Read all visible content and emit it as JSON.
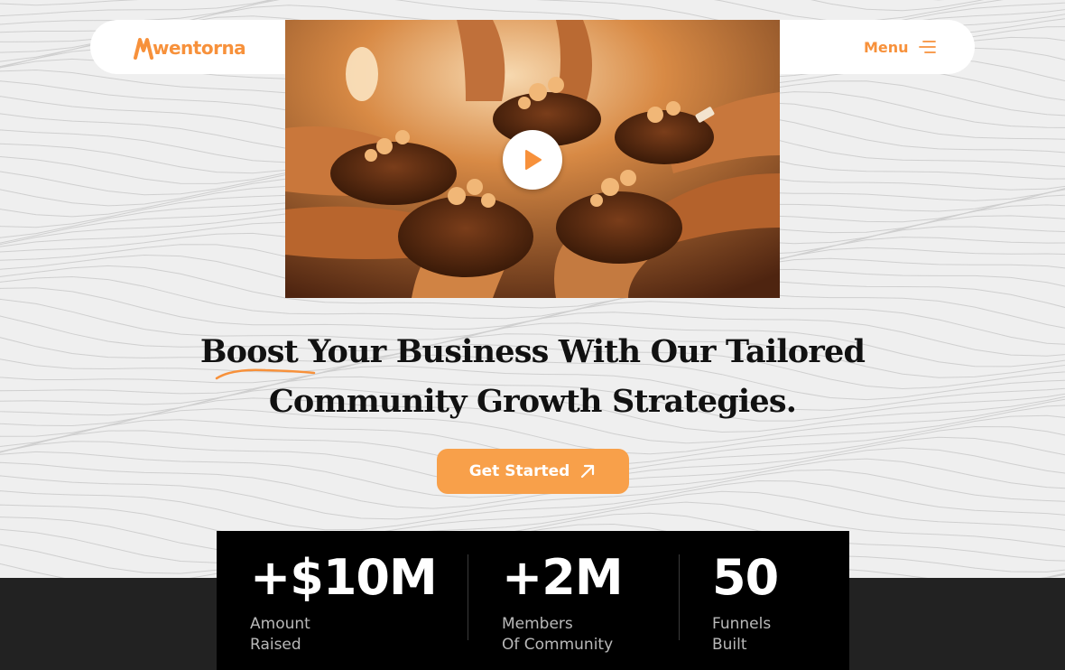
{
  "brand": {
    "name": "wentorna",
    "color": "#f7913b"
  },
  "nav": {
    "menu_label": "Menu",
    "menu_icon": "hamburger-icon"
  },
  "video": {
    "play_icon": "play-icon"
  },
  "hero": {
    "headline_highlight": "Boost",
    "headline_line1_rest": " Your Business With Our Tailored",
    "headline_line2": "Community Growth Strategies."
  },
  "cta": {
    "label": "Get Started",
    "icon": "arrow-up-right-icon",
    "color": "#f8a04a"
  },
  "stats": [
    {
      "value": "+$10M",
      "label_line1": "Amount",
      "label_line2": "Raised"
    },
    {
      "value": "+2M",
      "label_line1": "Members",
      "label_line2": "Of Community"
    },
    {
      "value": "50",
      "label_line1": "Funnels",
      "label_line2": "Built"
    }
  ]
}
